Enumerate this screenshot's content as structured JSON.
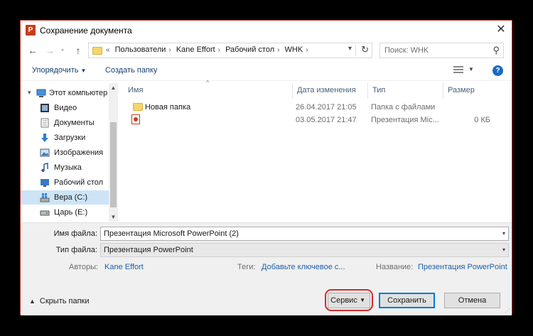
{
  "window": {
    "title": "Сохранение документа",
    "app_icon_letter": "P"
  },
  "nav": {
    "back": "←",
    "forward": "→",
    "up": "↑",
    "breadcrumbs": [
      "Пользователи",
      "Kane Effort",
      "Рабочий стол",
      "WHK"
    ],
    "crumb_prefix": "«",
    "search_placeholder": "Поиск: WHK"
  },
  "toolbar": {
    "organize": "Упорядочить",
    "new_folder": "Создать папку"
  },
  "sidebar": {
    "items": [
      {
        "label": "Этот компьютер",
        "icon": "computer-icon"
      },
      {
        "label": "Видео",
        "icon": "video-icon"
      },
      {
        "label": "Документы",
        "icon": "documents-icon"
      },
      {
        "label": "Загрузки",
        "icon": "downloads-icon"
      },
      {
        "label": "Изображения",
        "icon": "pictures-icon"
      },
      {
        "label": "Музыка",
        "icon": "music-icon"
      },
      {
        "label": "Рабочий стол",
        "icon": "desktop-icon"
      },
      {
        "label": "Вера (C:)",
        "icon": "drive-icon"
      },
      {
        "label": "Царь (E:)",
        "icon": "drive-icon"
      }
    ]
  },
  "files": {
    "columns": [
      "Имя",
      "Дата изменения",
      "Тип",
      "Размер"
    ],
    "rows": [
      {
        "name": "Новая папка",
        "date": "26.04.2017 21:05",
        "type": "Папка с файлами",
        "size": "",
        "icon": "folder-icon"
      },
      {
        "name": "",
        "date": "03.05.2017 21:47",
        "type": "Презентация Mic...",
        "size": "0 КБ",
        "icon": "powerpoint-file-icon"
      }
    ]
  },
  "form": {
    "filename_label": "Имя файла:",
    "filename_value": "Презентация Microsoft PowerPoint (2)",
    "filetype_label": "Тип файла:",
    "filetype_value": "Презентация PowerPoint",
    "authors_label": "Авторы:",
    "authors_value": "Kane Effort",
    "tags_label": "Теги:",
    "tags_value": "Добавьте ключевое с...",
    "title_label": "Название:",
    "title_value": "Презентация PowerPoint"
  },
  "footer": {
    "hide_folders": "Скрыть папки",
    "tools": "Сервис",
    "save": "Сохранить",
    "cancel": "Отмена"
  },
  "colors": {
    "highlight": "#d62a2a",
    "link": "#1d5fa8",
    "selected": "#cde4f7",
    "accent": "#0078d7"
  }
}
